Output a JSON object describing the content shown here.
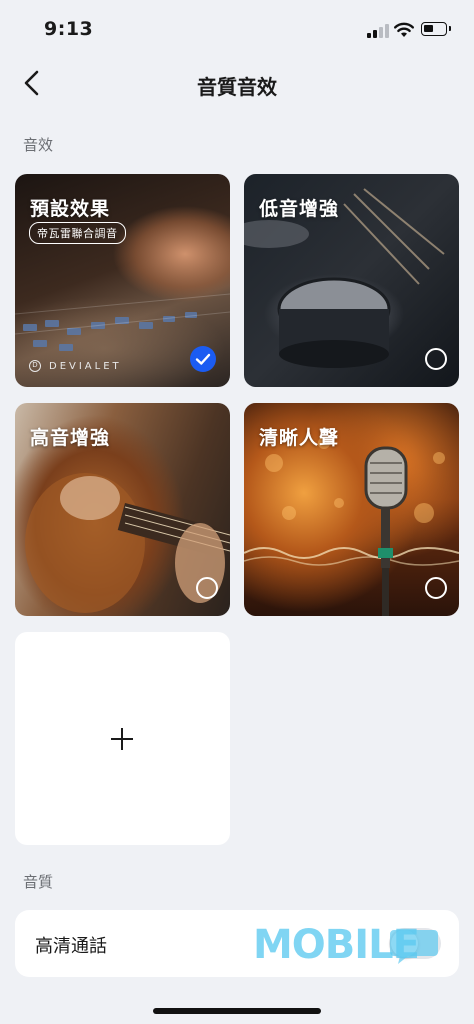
{
  "status_bar": {
    "time": "9:13"
  },
  "header": {
    "title": "音質音效"
  },
  "sound_effects": {
    "section_label": "音效",
    "cards": [
      {
        "title": "預設效果",
        "tag": "帝瓦雷聯合調音",
        "brand": "DEVIALET",
        "selected": true
      },
      {
        "title": "低音增強",
        "selected": false
      },
      {
        "title": "高音增強",
        "selected": false
      },
      {
        "title": "清晰人聲",
        "selected": false
      }
    ],
    "add_icon": "plus-icon"
  },
  "sound_quality": {
    "section_label": "音質",
    "hd_call_label": "高清通話",
    "hd_call_enabled": false
  },
  "watermark": {
    "text": "MOBILE"
  },
  "colors": {
    "accent": "#1b5cf2",
    "background": "#eff1f5"
  }
}
